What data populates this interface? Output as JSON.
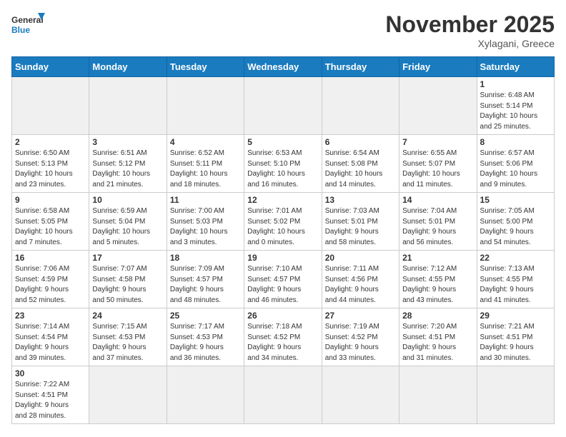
{
  "logo": {
    "general": "General",
    "blue": "Blue"
  },
  "title": "November 2025",
  "location": "Xylagani, Greece",
  "weekdays": [
    "Sunday",
    "Monday",
    "Tuesday",
    "Wednesday",
    "Thursday",
    "Friday",
    "Saturday"
  ],
  "days": [
    {
      "num": "",
      "info": "",
      "empty": true
    },
    {
      "num": "",
      "info": "",
      "empty": true
    },
    {
      "num": "",
      "info": "",
      "empty": true
    },
    {
      "num": "",
      "info": "",
      "empty": true
    },
    {
      "num": "",
      "info": "",
      "empty": true
    },
    {
      "num": "",
      "info": "",
      "empty": true
    },
    {
      "num": "1",
      "info": "Sunrise: 6:48 AM\nSunset: 5:14 PM\nDaylight: 10 hours\nand 25 minutes."
    },
    {
      "num": "2",
      "info": "Sunrise: 6:50 AM\nSunset: 5:13 PM\nDaylight: 10 hours\nand 23 minutes."
    },
    {
      "num": "3",
      "info": "Sunrise: 6:51 AM\nSunset: 5:12 PM\nDaylight: 10 hours\nand 21 minutes."
    },
    {
      "num": "4",
      "info": "Sunrise: 6:52 AM\nSunset: 5:11 PM\nDaylight: 10 hours\nand 18 minutes."
    },
    {
      "num": "5",
      "info": "Sunrise: 6:53 AM\nSunset: 5:10 PM\nDaylight: 10 hours\nand 16 minutes."
    },
    {
      "num": "6",
      "info": "Sunrise: 6:54 AM\nSunset: 5:08 PM\nDaylight: 10 hours\nand 14 minutes."
    },
    {
      "num": "7",
      "info": "Sunrise: 6:55 AM\nSunset: 5:07 PM\nDaylight: 10 hours\nand 11 minutes."
    },
    {
      "num": "8",
      "info": "Sunrise: 6:57 AM\nSunset: 5:06 PM\nDaylight: 10 hours\nand 9 minutes."
    },
    {
      "num": "9",
      "info": "Sunrise: 6:58 AM\nSunset: 5:05 PM\nDaylight: 10 hours\nand 7 minutes."
    },
    {
      "num": "10",
      "info": "Sunrise: 6:59 AM\nSunset: 5:04 PM\nDaylight: 10 hours\nand 5 minutes."
    },
    {
      "num": "11",
      "info": "Sunrise: 7:00 AM\nSunset: 5:03 PM\nDaylight: 10 hours\nand 3 minutes."
    },
    {
      "num": "12",
      "info": "Sunrise: 7:01 AM\nSunset: 5:02 PM\nDaylight: 10 hours\nand 0 minutes."
    },
    {
      "num": "13",
      "info": "Sunrise: 7:03 AM\nSunset: 5:01 PM\nDaylight: 9 hours\nand 58 minutes."
    },
    {
      "num": "14",
      "info": "Sunrise: 7:04 AM\nSunset: 5:01 PM\nDaylight: 9 hours\nand 56 minutes."
    },
    {
      "num": "15",
      "info": "Sunrise: 7:05 AM\nSunset: 5:00 PM\nDaylight: 9 hours\nand 54 minutes."
    },
    {
      "num": "16",
      "info": "Sunrise: 7:06 AM\nSunset: 4:59 PM\nDaylight: 9 hours\nand 52 minutes."
    },
    {
      "num": "17",
      "info": "Sunrise: 7:07 AM\nSunset: 4:58 PM\nDaylight: 9 hours\nand 50 minutes."
    },
    {
      "num": "18",
      "info": "Sunrise: 7:09 AM\nSunset: 4:57 PM\nDaylight: 9 hours\nand 48 minutes."
    },
    {
      "num": "19",
      "info": "Sunrise: 7:10 AM\nSunset: 4:57 PM\nDaylight: 9 hours\nand 46 minutes."
    },
    {
      "num": "20",
      "info": "Sunrise: 7:11 AM\nSunset: 4:56 PM\nDaylight: 9 hours\nand 44 minutes."
    },
    {
      "num": "21",
      "info": "Sunrise: 7:12 AM\nSunset: 4:55 PM\nDaylight: 9 hours\nand 43 minutes."
    },
    {
      "num": "22",
      "info": "Sunrise: 7:13 AM\nSunset: 4:55 PM\nDaylight: 9 hours\nand 41 minutes."
    },
    {
      "num": "23",
      "info": "Sunrise: 7:14 AM\nSunset: 4:54 PM\nDaylight: 9 hours\nand 39 minutes."
    },
    {
      "num": "24",
      "info": "Sunrise: 7:15 AM\nSunset: 4:53 PM\nDaylight: 9 hours\nand 37 minutes."
    },
    {
      "num": "25",
      "info": "Sunrise: 7:17 AM\nSunset: 4:53 PM\nDaylight: 9 hours\nand 36 minutes."
    },
    {
      "num": "26",
      "info": "Sunrise: 7:18 AM\nSunset: 4:52 PM\nDaylight: 9 hours\nand 34 minutes."
    },
    {
      "num": "27",
      "info": "Sunrise: 7:19 AM\nSunset: 4:52 PM\nDaylight: 9 hours\nand 33 minutes."
    },
    {
      "num": "28",
      "info": "Sunrise: 7:20 AM\nSunset: 4:51 PM\nDaylight: 9 hours\nand 31 minutes."
    },
    {
      "num": "29",
      "info": "Sunrise: 7:21 AM\nSunset: 4:51 PM\nDaylight: 9 hours\nand 30 minutes."
    },
    {
      "num": "30",
      "info": "Sunrise: 7:22 AM\nSunset: 4:51 PM\nDaylight: 9 hours\nand 28 minutes."
    },
    {
      "num": "",
      "info": "",
      "empty": true
    },
    {
      "num": "",
      "info": "",
      "empty": true
    },
    {
      "num": "",
      "info": "",
      "empty": true
    },
    {
      "num": "",
      "info": "",
      "empty": true
    },
    {
      "num": "",
      "info": "",
      "empty": true
    },
    {
      "num": "",
      "info": "",
      "empty": true
    }
  ]
}
